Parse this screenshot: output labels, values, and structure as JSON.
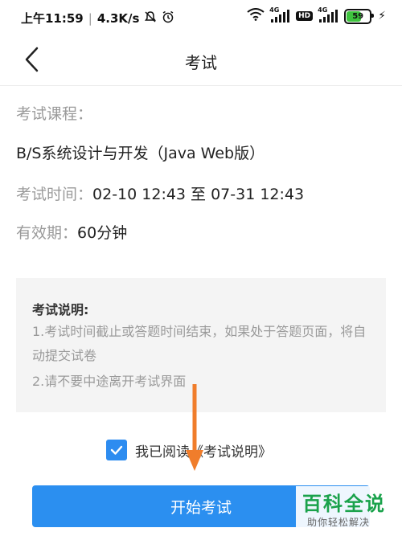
{
  "status_bar": {
    "time": "上午11:59",
    "speed": "4.3K/s",
    "network_tag": "4G",
    "hd": "HD",
    "battery": "59",
    "battery_level": 0.59
  },
  "nav": {
    "title": "考试"
  },
  "exam": {
    "course_label": "考试课程：",
    "course_name": "B/S系统设计与开发（Java Web版）",
    "time_label": "考试时间：",
    "time_value": "02-10 12:43 至 07-31 12:43",
    "valid_label": "有效期：",
    "valid_value": "60分钟"
  },
  "notes": {
    "title": "考试说明:",
    "items": [
      "1.考试时间截止或答题时间结束，如果处于答题页面，将自动提交试卷",
      "2.请不要中途离开考试界面"
    ]
  },
  "agreement": {
    "checked": true,
    "text": "我已阅读《考试说明》"
  },
  "start_button": {
    "label": "开始考试"
  },
  "watermark": {
    "main": "百科全说",
    "sub": "助你轻松解决"
  },
  "colors": {
    "accent": "#2b8ff0",
    "annotation_arrow": "#f07d2b",
    "watermark_green": "#1aa24b"
  }
}
